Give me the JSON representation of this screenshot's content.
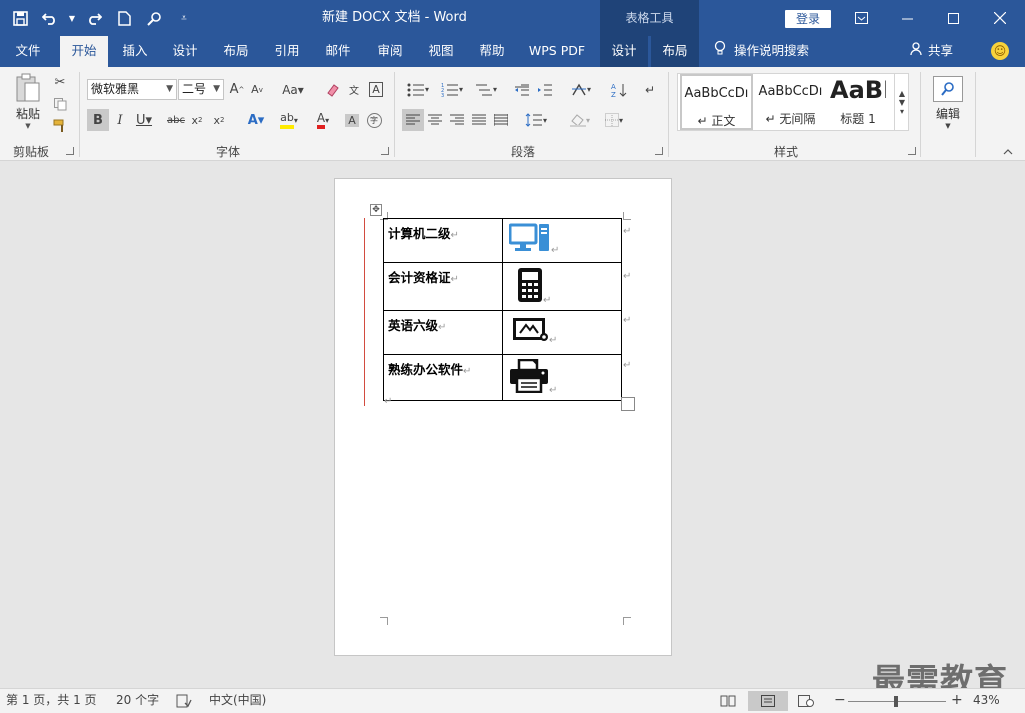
{
  "titlebar": {
    "title": "新建 DOCX 文档  -  Word",
    "table_tools": "表格工具",
    "login": "登录",
    "qat": {
      "save_icon": "save-icon",
      "undo_icon": "undo-icon",
      "redo_icon": "redo-icon",
      "new_icon": "new-doc-icon",
      "touch_icon": "touch-mode-icon",
      "customize_icon": "customize-icon"
    },
    "window_controls": {
      "ribbon_options": "ribbon-display-icon",
      "minimize": "minimize-icon",
      "maximize": "maximize-icon",
      "close": "close-icon"
    }
  },
  "tabs": [
    "文件",
    "开始",
    "插入",
    "设计",
    "布局",
    "引用",
    "邮件",
    "审阅",
    "视图",
    "帮助",
    "WPS PDF",
    "设计",
    "布局"
  ],
  "tell_me": "操作说明搜索",
  "share": "共享",
  "ribbon": {
    "clipboard": {
      "label": "剪贴板",
      "paste": "粘贴"
    },
    "font": {
      "label": "字体",
      "font_name": "微软雅黑",
      "font_size": "二号"
    },
    "paragraph": {
      "label": "段落"
    },
    "styles": {
      "label": "样式",
      "items": [
        {
          "preview": "AaBbCcDı",
          "name": "正文"
        },
        {
          "preview": "AaBbCcDı",
          "name": "无间隔"
        },
        {
          "preview": "AaBI",
          "name": "标题 1"
        }
      ]
    },
    "editing": {
      "label": "编辑"
    }
  },
  "document": {
    "rows": [
      {
        "text": "计算机二级",
        "icon": "computer-icon"
      },
      {
        "text": "会计资格证",
        "icon": "calculator-icon"
      },
      {
        "text": "英语六级",
        "icon": "certificate-icon"
      },
      {
        "text": "熟练办公软件",
        "icon": "printer-icon"
      }
    ],
    "paragraph_mark": "↵"
  },
  "statusbar": {
    "page": "第 1 页，共 1 页",
    "words": "20 个字",
    "language": "中文(中国)",
    "zoom": "43%",
    "zoom_level": 0.43
  },
  "watermark": "最需教育",
  "colors": {
    "brand": "#2b579a",
    "table_tools": "#1f4378",
    "ribbon": "#f3f3f3"
  }
}
